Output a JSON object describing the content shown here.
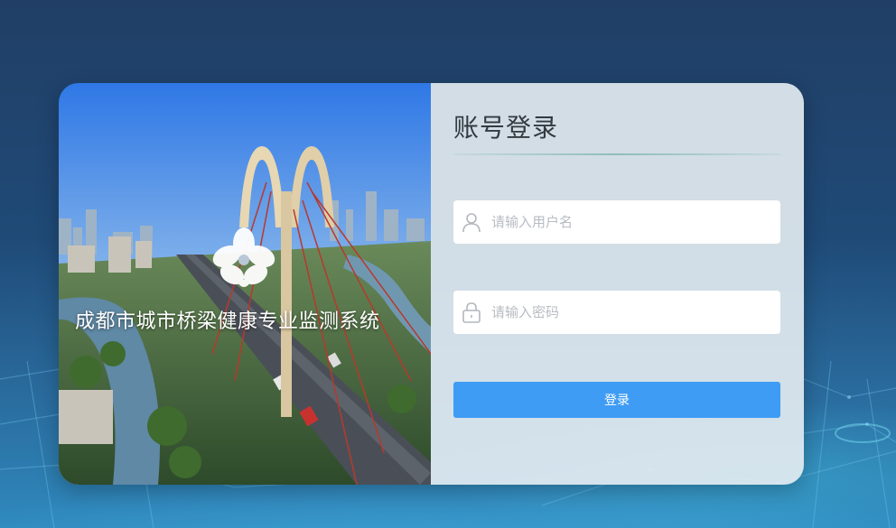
{
  "brand": {
    "system_name": "成都市城市桥梁健康专业监测系统"
  },
  "login": {
    "title": "账号登录",
    "username_placeholder": "请输入用户名",
    "password_placeholder": "请输入密码",
    "submit_label": "登录"
  },
  "icons": {
    "username": "user-icon",
    "password": "lock-icon",
    "logo": "flower-logo-icon"
  },
  "colors": {
    "accent": "#3f9cf4",
    "panel": "#e2eaf0",
    "background": "#213f66"
  }
}
